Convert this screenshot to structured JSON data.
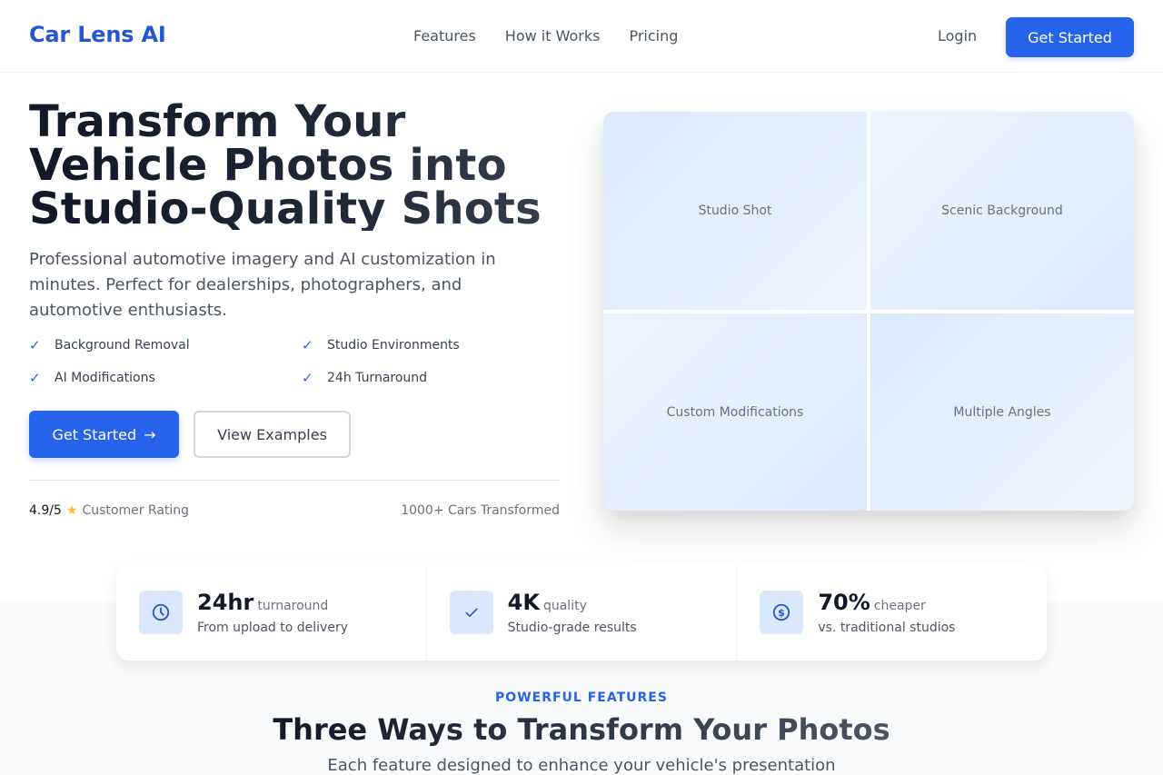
{
  "nav": {
    "logo": "Car Lens AI",
    "links": [
      "Features",
      "How it Works",
      "Pricing"
    ],
    "login": "Login",
    "cta": "Get Started"
  },
  "hero": {
    "title_lines": [
      "Transform Your",
      "Vehicle Photos into",
      "Studio-Quality Shots"
    ],
    "subtitle": "Professional automotive imagery and AI customization in minutes. Perfect for dealerships, photographers, and automotive enthusiasts.",
    "features": [
      "Background Removal",
      "Studio Environments",
      "AI Modifications",
      "24h Turnaround"
    ],
    "feature_icon": "check-icon",
    "primary_button": "Get Started",
    "primary_button_icon": "→",
    "secondary_button": "View Examples",
    "rating_value": "4.9/5",
    "rating_icon": "★",
    "rating_label": "Customer Rating",
    "cars_transformed": "1000+ Cars Transformed"
  },
  "showcase": {
    "tiles": [
      "Studio Shot",
      "Scenic Background",
      "Custom Modifications",
      "Multiple Angles"
    ]
  },
  "stats": [
    {
      "icon": "clock-icon",
      "value": "24hr",
      "unit": "turnaround",
      "desc": "From upload to delivery"
    },
    {
      "icon": "check-icon",
      "value": "4K",
      "unit": "quality",
      "desc": "Studio-grade results"
    },
    {
      "icon": "dollar-icon",
      "value": "70%",
      "unit": "cheaper",
      "desc": "vs. traditional studios"
    }
  ],
  "features_section": {
    "eyebrow": "POWERFUL FEATURES",
    "title": "Three Ways to Transform Your Photos",
    "subtitle": "Each feature designed to enhance your vehicle's presentation"
  },
  "colors": {
    "accent": "#2563eb",
    "logo": "#2456d3",
    "star": "#fbbf24",
    "tile_light": "#dbe8fc"
  }
}
